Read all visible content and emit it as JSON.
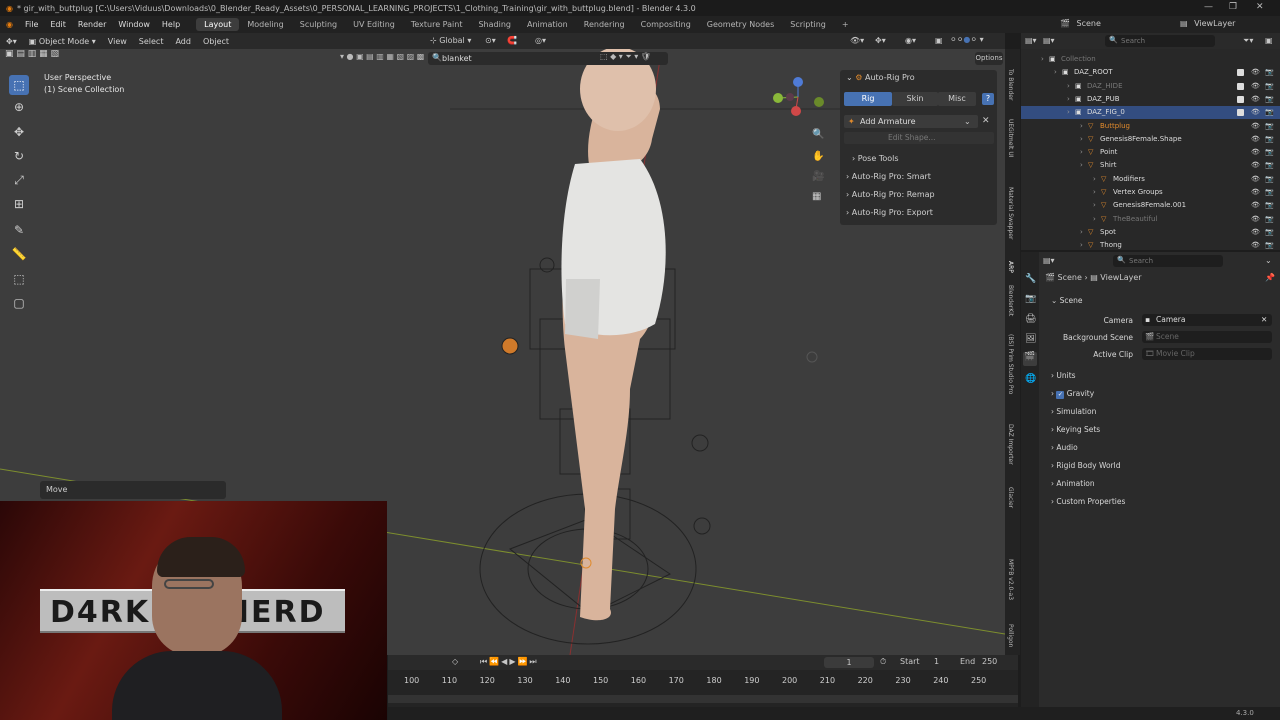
{
  "window": {
    "title": "* gir_with_buttplug [C:\\Users\\Viduus\\Downloads\\0_Blender_Ready_Assets\\0_PERSONAL_LEARNING_PROJECTS\\1_Clothing_Training\\gir_with_buttplug.blend] - Blender 4.3.0"
  },
  "menu": {
    "items": [
      "File",
      "Edit",
      "Render",
      "Window",
      "Help"
    ],
    "workspaces": [
      "Layout",
      "Modeling",
      "Sculpting",
      "UV Editing",
      "Texture Paint",
      "Shading",
      "Animation",
      "Rendering",
      "Compositing",
      "Geometry Nodes",
      "Scripting"
    ],
    "active_workspace": "Layout",
    "add_tab": "+"
  },
  "top_right": {
    "scene": "Scene",
    "view_layer": "ViewLayer"
  },
  "viewport_header": {
    "mode": "Object Mode",
    "view": "View",
    "select": "Select",
    "add": "Add",
    "object": "Object",
    "orientation": "Global",
    "options": "Options",
    "search_value": "blanket"
  },
  "viewport": {
    "perspective": "User Perspective",
    "collection": "(1) Scene Collection",
    "move_panel": "Move"
  },
  "npanel": {
    "title": "Auto-Rig Pro",
    "tabs": [
      "Rig",
      "Skin",
      "Misc"
    ],
    "active_tab": "Rig",
    "add_armature": "Add Armature",
    "edit_shape": "Edit Shape...",
    "sections": [
      "Pose Tools",
      "Auto-Rig Pro: Smart",
      "Auto-Rig Pro: Remap",
      "Auto-Rig Pro: Export"
    ]
  },
  "side_tabs": [
    "To Blender",
    "UEGitmelt UI",
    "Material Swapper",
    "ARP",
    "BlenderKit",
    "(BS) Prim Studio Pro",
    "DAZ Importer",
    "Glacier",
    "MPFB v2.0-a3",
    "Polligon"
  ],
  "outliner": {
    "search_placeholder": "Search",
    "rows": [
      {
        "label": "Collection",
        "indent": 0,
        "dim": true
      },
      {
        "label": "DAZ_ROOT",
        "indent": 1
      },
      {
        "label": "DAZ_HIDE",
        "indent": 2,
        "dim": true
      },
      {
        "label": "DAZ_PUB",
        "indent": 2
      },
      {
        "label": "DAZ_FIG_0",
        "indent": 2,
        "selected": true
      },
      {
        "label": "Buttplug",
        "indent": 3,
        "orange": true
      },
      {
        "label": "Genesis8Female.Shape",
        "indent": 3
      },
      {
        "label": "Point",
        "indent": 3
      },
      {
        "label": "Shirt",
        "indent": 3
      },
      {
        "label": "Modifiers",
        "indent": 4
      },
      {
        "label": "Vertex Groups",
        "indent": 4
      },
      {
        "label": "Genesis8Female.001",
        "indent": 4
      },
      {
        "label": "TheBeautiful",
        "indent": 4,
        "dim": true
      },
      {
        "label": "Spot",
        "indent": 3
      },
      {
        "label": "Thong",
        "indent": 3
      }
    ]
  },
  "properties": {
    "search_placeholder": "Search",
    "breadcrumb": [
      "Scene",
      "ViewLayer"
    ],
    "scene_section": "Scene",
    "camera_label": "Camera",
    "camera_value": "Camera",
    "background_label": "Background Scene",
    "background_value": "Scene",
    "active_clip_label": "Active Clip",
    "active_clip_value": "Movie Clip",
    "panels": [
      "Units",
      "Gravity",
      "Simulation",
      "Keying Sets",
      "Audio",
      "Rigid Body World",
      "Animation",
      "Custom Properties"
    ]
  },
  "timeline": {
    "current_frame": "1",
    "start_label": "Start",
    "start": "1",
    "end_label": "End",
    "end": "250",
    "ticks": [
      "100",
      "110",
      "120",
      "130",
      "140",
      "150",
      "160",
      "170",
      "180",
      "190",
      "200",
      "210",
      "220",
      "230",
      "240",
      "250"
    ]
  },
  "webcam": {
    "banner": "D4RK    PHERD"
  },
  "status": {
    "version": "4.3.0"
  },
  "colors": {
    "accent": "#4772b3",
    "selection": "#334d80",
    "orange": "#e08a2c"
  }
}
